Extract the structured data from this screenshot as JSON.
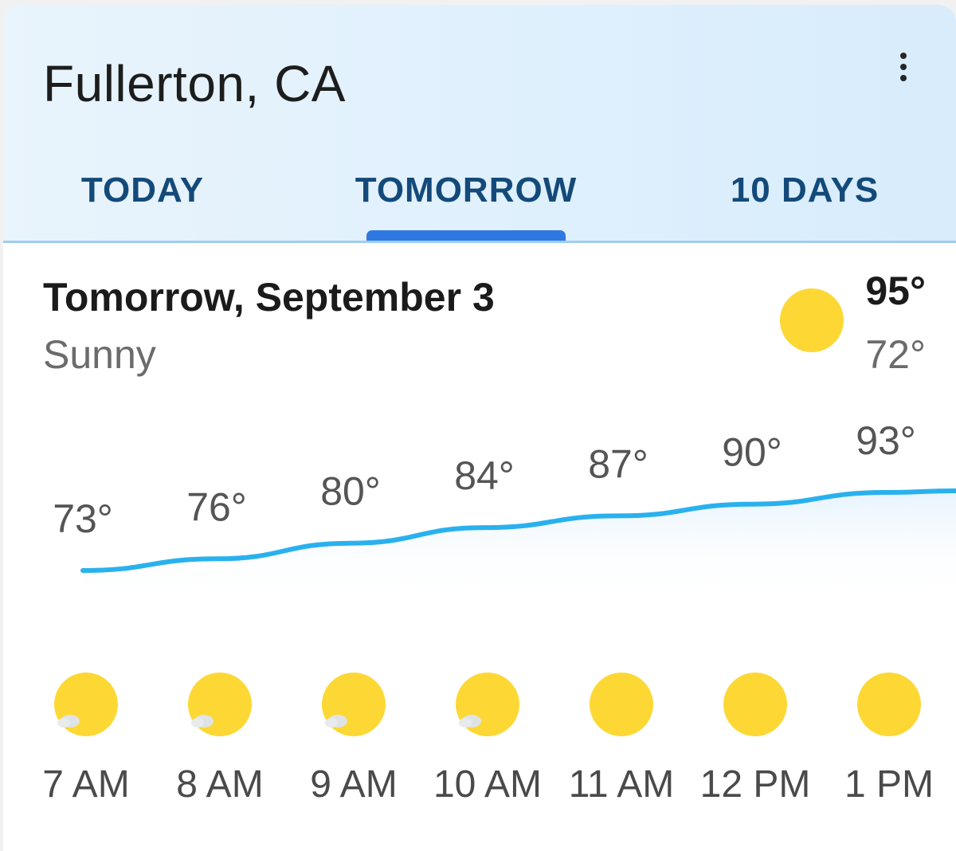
{
  "header": {
    "location": "Fullerton, CA",
    "menu_icon": "more-vert-icon"
  },
  "tabs": [
    {
      "label": "TODAY",
      "selected": false
    },
    {
      "label": "TOMORROW",
      "selected": true
    },
    {
      "label": "10 DAYS",
      "selected": false
    }
  ],
  "summary": {
    "date": "Tomorrow, September 3",
    "condition": "Sunny",
    "icon": "sun-icon",
    "high": "95°",
    "low": "72°"
  },
  "colors": {
    "accent": "#2f78e2",
    "line": "#29b1ee",
    "sun": "#fdd835",
    "tab_text": "#134a7a"
  },
  "chart_data": {
    "type": "line",
    "x": [
      "7 AM",
      "8 AM",
      "9 AM",
      "10 AM",
      "11 AM",
      "12 PM",
      "1 PM"
    ],
    "values": [
      73,
      76,
      80,
      84,
      87,
      90,
      93
    ],
    "value_labels": [
      "73°",
      "76°",
      "80°",
      "84°",
      "87°",
      "90°",
      "93°"
    ],
    "icons": [
      "sun-cloud-icon",
      "sun-cloud-icon",
      "sun-cloud-icon",
      "sun-cloud-icon",
      "sun-icon",
      "sun-icon",
      "sun-icon"
    ]
  }
}
